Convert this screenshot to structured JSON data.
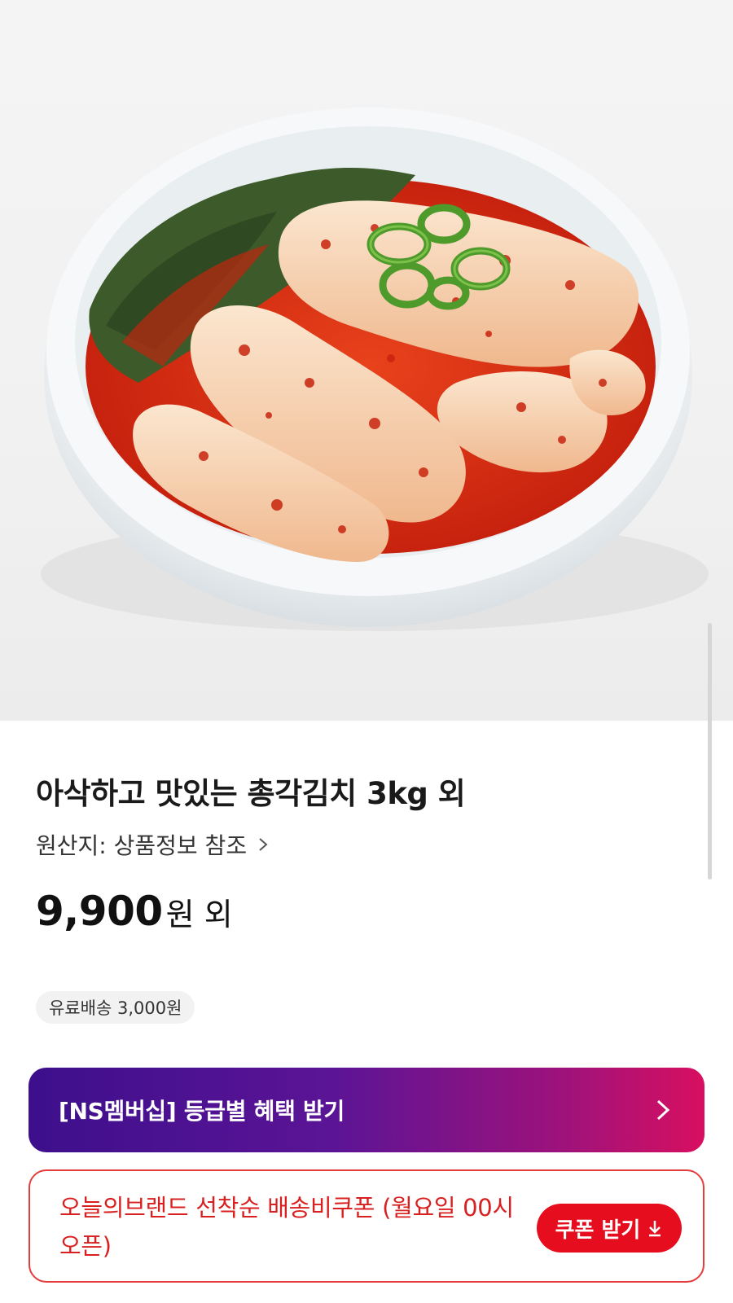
{
  "product": {
    "image_alt": "총각김치 in white bowl",
    "title": "아삭하고 맛있는 총각김치 3kg 외",
    "origin": "원산지: 상품정보 참조",
    "price_number": "9,900",
    "price_unit": "원 외",
    "shipping": "유료배송 3,000원"
  },
  "membership": {
    "label": "[NS멤버십] 등급별 혜택 받기"
  },
  "coupon": {
    "text": "오늘의브랜드 선착순 배송비쿠폰 (월요일 00시 오픈)",
    "button_label": "쿠폰 받기"
  },
  "colors": {
    "coupon_red": "#e60e1e",
    "membership_start": "#3d0f8c",
    "membership_end": "#d80f60"
  },
  "icons": {
    "origin_link": "chevron-right-icon",
    "membership_link": "chevron-right-icon",
    "coupon_download": "download-arrow-icon"
  }
}
